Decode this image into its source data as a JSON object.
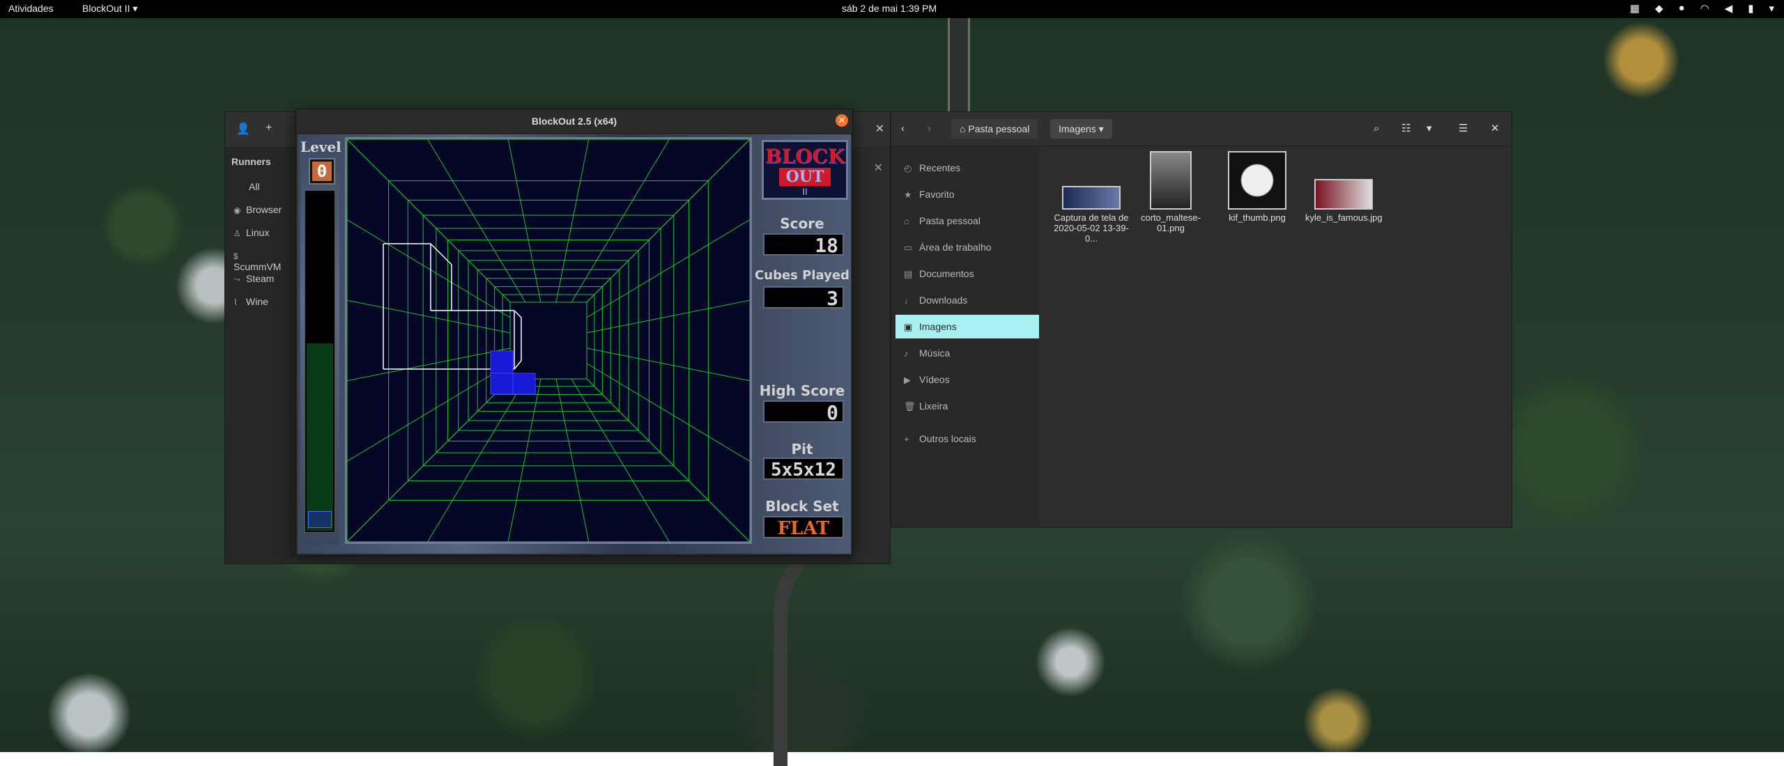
{
  "topbar": {
    "activities": "Atividades",
    "app_menu": "BlockOut II ▾",
    "clock": "sáb 2 de mai   1:39 PM"
  },
  "lutris": {
    "runners_title": "Runners",
    "items": [
      {
        "label": "All",
        "icon": ""
      },
      {
        "label": "Browser",
        "icon": "browser-icon"
      },
      {
        "label": "Linux",
        "icon": "linux-icon"
      },
      {
        "label": "ScummVM",
        "icon": "scummvm-icon"
      },
      {
        "label": "Steam",
        "icon": "steam-icon"
      },
      {
        "label": "Wine",
        "icon": "wine-icon"
      }
    ]
  },
  "blockout": {
    "title": "BlockOut 2.5 (x64)",
    "level_label": "Level",
    "level": "0",
    "logo_line1": "BLOCK",
    "logo_line2": "OUT",
    "logo_line3": "II",
    "score_label": "Score",
    "score": "18",
    "cubes_label": "Cubes Played",
    "cubes": "3",
    "high_label": "High Score",
    "high": "0",
    "pit_label": "Pit",
    "pit": "5x5x12",
    "blockset_label": "Block Set",
    "blockset": "FLAT",
    "level_progress_fraction": 0.55
  },
  "files": {
    "crumb_home": "Pasta pessoal",
    "crumb_current": "Imagens",
    "places": [
      {
        "label": "Recentes",
        "icon": "clock-icon"
      },
      {
        "label": "Favorito",
        "icon": "star-icon"
      },
      {
        "label": "Pasta pessoal",
        "icon": "home-icon"
      },
      {
        "label": "Área de trabalho",
        "icon": "desktop-icon"
      },
      {
        "label": "Documentos",
        "icon": "document-icon"
      },
      {
        "label": "Downloads",
        "icon": "download-icon"
      },
      {
        "label": "Imagens",
        "icon": "image-icon",
        "selected": true
      },
      {
        "label": "Música",
        "icon": "music-icon"
      },
      {
        "label": "Vídeos",
        "icon": "video-icon"
      },
      {
        "label": "Lixeira",
        "icon": "trash-icon"
      },
      {
        "label": "Outros locais",
        "icon": "plus-icon"
      }
    ],
    "files": [
      {
        "name": "Captura de tela de 2020-05-02 13-39-0..."
      },
      {
        "name": "corto_maltese-01.png"
      },
      {
        "name": "kif_thumb.png"
      },
      {
        "name": "kyle_is_famous.jpg"
      }
    ]
  },
  "colors": {
    "accent": "#a9f0f3",
    "grid": "#18c830",
    "piece": "#1a1ad6"
  }
}
